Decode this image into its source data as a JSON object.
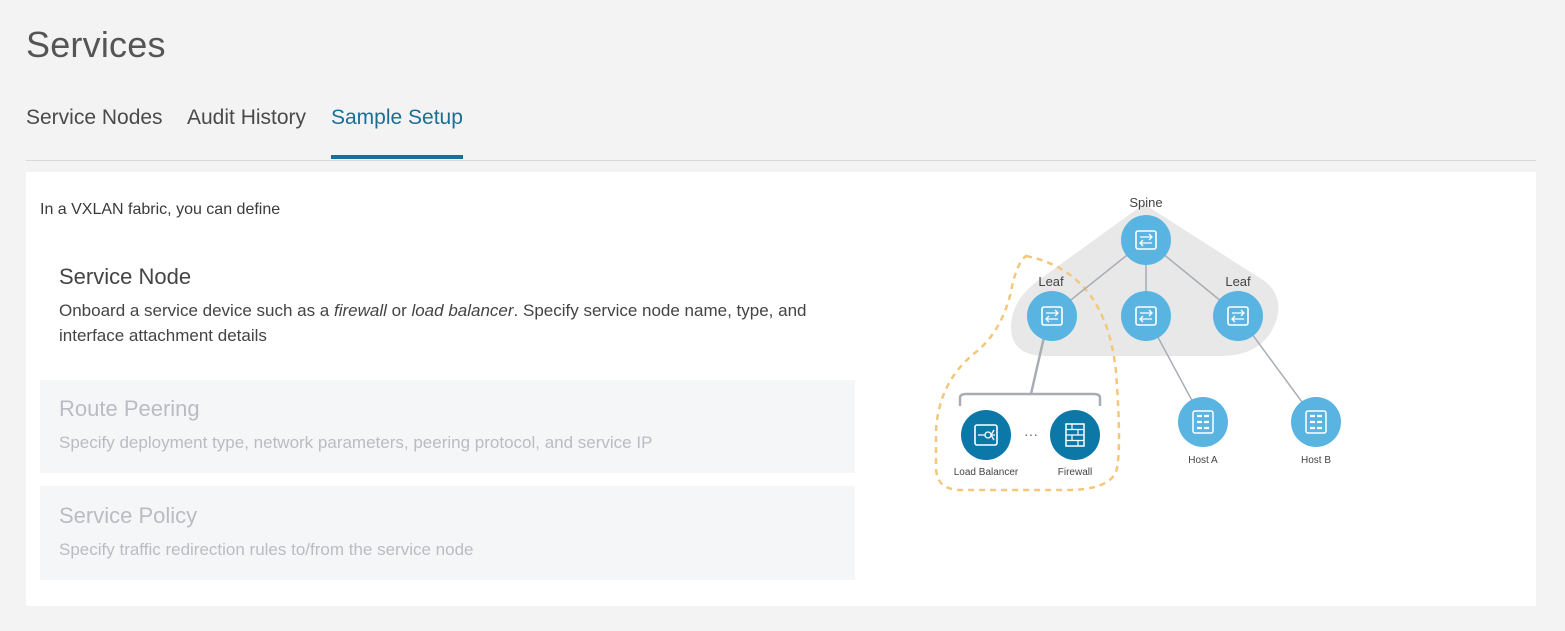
{
  "page": {
    "title": "Services"
  },
  "tabs": [
    {
      "label": "Service Nodes",
      "active": false
    },
    {
      "label": "Audit History",
      "active": false
    },
    {
      "label": "Sample Setup",
      "active": true
    }
  ],
  "content": {
    "intro": "In a VXLAN fabric, you can define",
    "steps": [
      {
        "title": "Service Node",
        "desc_before": "Onboard a service device such as a ",
        "desc_em1": "firewall",
        "desc_mid": " or ",
        "desc_em2": "load balancer",
        "desc_after": ". Specify service node name, type, and interface attachment details"
      },
      {
        "title": "Route Peering",
        "desc": "Specify deployment type, network parameters, peering protocol, and service IP"
      },
      {
        "title": "Service Policy",
        "desc": "Specify traffic redirection rules to/from the service node"
      }
    ]
  },
  "diagram": {
    "spine_label": "Spine",
    "leaf_left_label": "Leaf",
    "leaf_right_label": "Leaf",
    "load_balancer_label": "Load Balancer",
    "ellipsis": "···",
    "firewall_label": "Firewall",
    "host_a_label": "Host A",
    "host_b_label": "Host B",
    "colors": {
      "switch": "#5ab4e1",
      "service_node": "#0b78a8",
      "fabric_bg": "#e8e8e8",
      "highlight": "#f4c77a",
      "link": "#a8adb3"
    }
  }
}
